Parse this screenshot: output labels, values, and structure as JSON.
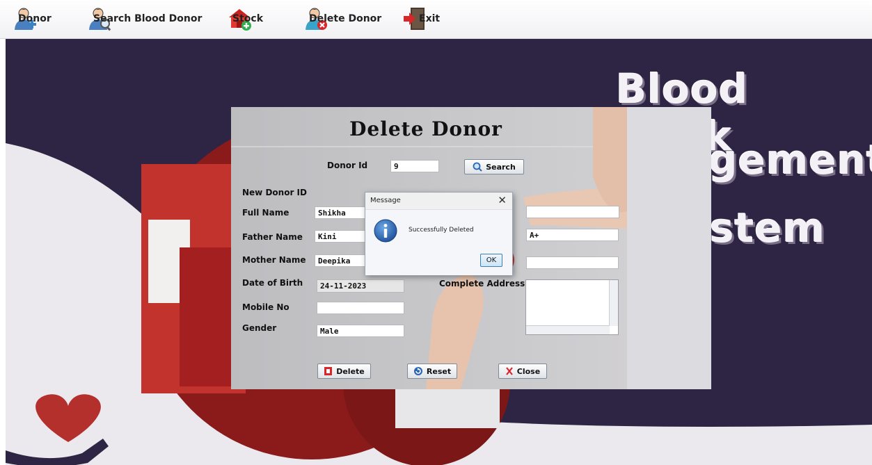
{
  "menu": {
    "items": [
      {
        "label": "Donor",
        "icon": "add-user-icon"
      },
      {
        "label": "Search Blood Donor",
        "icon": "search-user-icon"
      },
      {
        "label": "Stock",
        "icon": "stock-house-icon"
      },
      {
        "label": "Delete Donor",
        "icon": "delete-user-icon"
      },
      {
        "label": "Exit",
        "icon": "exit-door-icon"
      }
    ]
  },
  "background": {
    "title_lines": [
      "Blood Bank",
      "gement",
      "stem"
    ],
    "colors": {
      "dark": "#2e2444",
      "light": "#e8e6ec",
      "heart": "#b3302c"
    }
  },
  "form": {
    "title": "Delete Donor",
    "donor_id_label": "Donor Id",
    "donor_id_value": "9",
    "search_label": "Search",
    "new_donor_id_label": "New Donor ID",
    "full_name_label": "Full Name",
    "full_name_value": "Shikha",
    "father_name_label": "Father Name",
    "father_name_value": "Kini",
    "mother_name_label": "Mother Name",
    "mother_name_value": "Deepika",
    "dob_label": "Date of Birth",
    "dob_value": "24-11-2023",
    "mobile_label": "Mobile No",
    "mobile_value": "",
    "gender_label": "Gender",
    "gender_value": "Male",
    "blood_group_value": "A+",
    "address_label": "Complete Address",
    "delete_label": "Delete",
    "reset_label": "Reset",
    "close_label": "Close"
  },
  "dialog": {
    "title": "Message",
    "close_glyph": "✕",
    "message": "Successfully Deleted",
    "ok_label": "OK",
    "icon": "info-icon",
    "accent": "#2563b0"
  }
}
